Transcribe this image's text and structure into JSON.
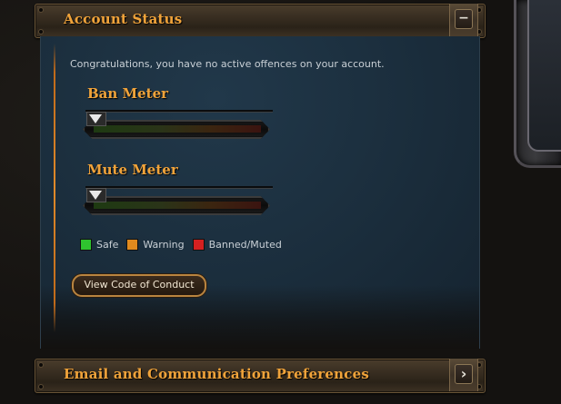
{
  "account_status": {
    "title": "Account Status",
    "collapse_glyph": "−",
    "message": "Congratulations, you have no active offences on your account.",
    "ban_meter": {
      "title": "Ban Meter",
      "level": 0
    },
    "mute_meter": {
      "title": "Mute Meter",
      "level": 0
    },
    "legend": [
      {
        "label": "Safe",
        "color": "#2fc32f"
      },
      {
        "label": "Warning",
        "color": "#e08a1e"
      },
      {
        "label": "Banned/Muted",
        "color": "#d42020"
      }
    ],
    "code_of_conduct_button": "View Code of Conduct"
  },
  "email_prefs": {
    "title": "Email and Communication Preferences",
    "expand_glyph": "›"
  },
  "colors": {
    "accent_title": "#f0a33a",
    "panel_bg": "#1b2e3d"
  }
}
